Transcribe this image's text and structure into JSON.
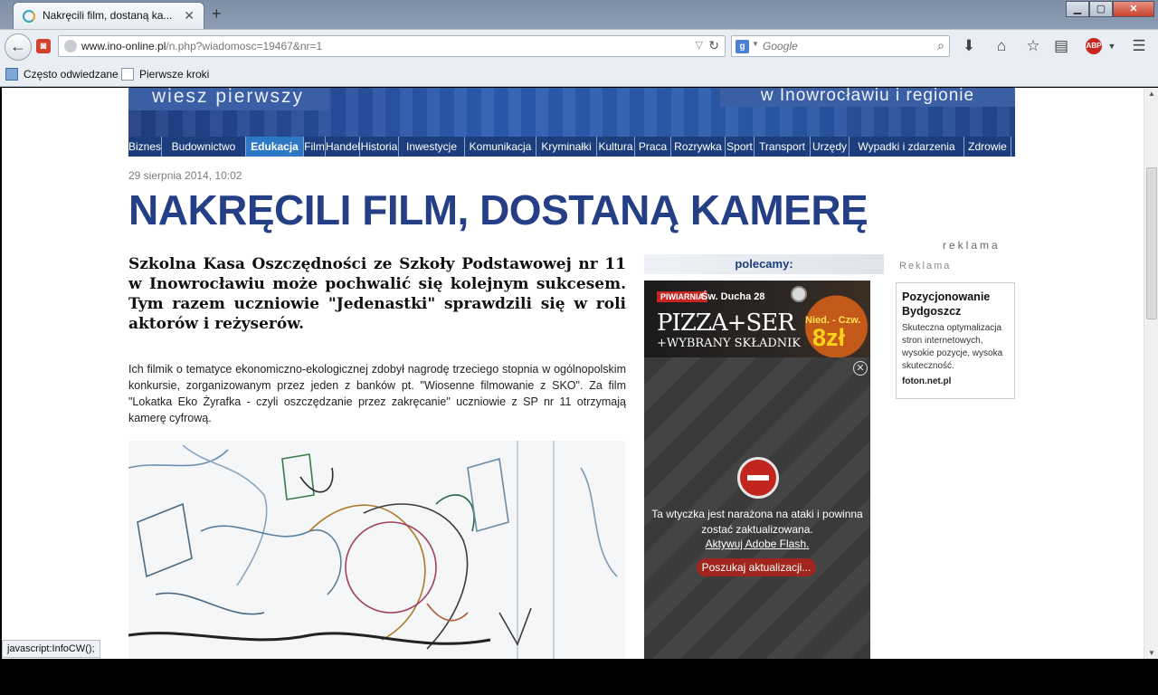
{
  "browser": {
    "tab_title": "Nakręcili film, dostaną ka...",
    "tab_close": "✕",
    "new_tab": "+",
    "url_host": "www.ino-online.pl",
    "url_path": "/n.php?wiadomosc=19467&nr=1",
    "search_engine": "g",
    "search_placeholder": "Google",
    "bookmarks": [
      "Często odwiedzane",
      "Pierwsze kroki"
    ],
    "abp_label": "ABP",
    "status_text": "javascript:InfoCW();"
  },
  "site": {
    "banner_left": "wiesz pierwszy",
    "banner_right": "w Inowrocławiu i regionie",
    "nav": [
      "Biznes",
      "Budownictwo",
      "Edukacja",
      "Film",
      "Handel",
      "Historia",
      "Inwestycje",
      "Komunikacja",
      "Kryminałki",
      "Kultura",
      "Praca",
      "Rozrywka",
      "Sport",
      "Transport",
      "Urzędy",
      "Wypadki i zdarzenia",
      "Zdrowie"
    ],
    "nav_active": "Edukacja"
  },
  "article": {
    "date": "29 sierpnia 2014, 10:02",
    "title": "NAKRĘCILI FILM, DOSTANĄ KAMERĘ",
    "lead": "Szkolna Kasa Oszczędności ze Szkoły Podstawowej nr 11 w Inowrocławiu może pochwalić się kolejnym sukcesem. Tym razem uczniowie \"Jedenastki\" sprawdzili się w roli aktorów i reżyserów.",
    "body": "Ich filmik o tematyce ekonomiczno-ekologicznej zdobył nagrodę trzeciego stopnia w ogólnopolskim konkursie, zorganizowanym przez jeden z banków pt. \"Wiosenne filmowanie z SKO\". Za film \"Lokatka Eko Żyrafka - czyli oszczędzanie przez zakręcanie\" uczniowie z SP nr 11 otrzymają kamerę cyfrową."
  },
  "sidebar": {
    "polecamy": "polecamy:",
    "pizza_ad": {
      "brand": "PIWIARNIA",
      "address": "Św. Ducha 28",
      "headline": "PIZZA+SER",
      "subline": "+WYBRANY SKŁADNIK",
      "days": "Nied. - Czw.",
      "price": "8zł"
    },
    "flash": {
      "message": "Ta wtyczka jest narażona na ataki i powinna zostać zaktualizowana.",
      "link": "Aktywuj Adobe Flash.",
      "button": "Poszukaj aktualizacji...",
      "close": "✕"
    }
  },
  "ads": {
    "reklama_top": "reklama",
    "reklama_side": "Reklama",
    "title": "Pozycjonowanie Bydgoszcz",
    "description": "Skuteczna optymalizacja stron internetowych, wysokie pozycje, wysoka skuteczność.",
    "domain": "foton.net.pl"
  }
}
